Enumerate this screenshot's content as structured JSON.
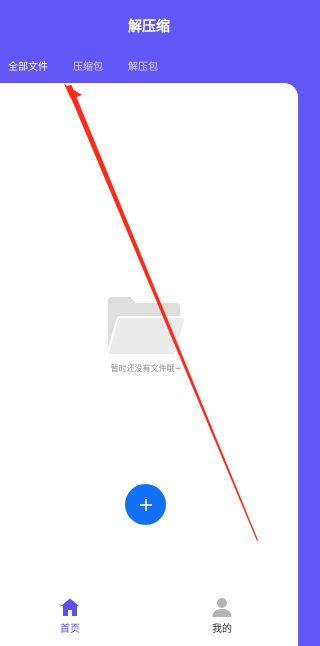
{
  "header": {
    "title": "解压缩"
  },
  "tabs": [
    {
      "label": "全部文件",
      "active": true
    },
    {
      "label": "压缩包",
      "active": false
    },
    {
      "label": "解压包",
      "active": false
    }
  ],
  "empty_state": {
    "icon": "empty-folder-icon",
    "message": "暂时还没有文件哦~"
  },
  "fab": {
    "icon": "plus-icon",
    "color": "#1270f5"
  },
  "bottom_nav": [
    {
      "label": "首页",
      "icon": "home-icon",
      "active": true
    },
    {
      "label": "我的",
      "icon": "user-icon",
      "active": false
    }
  ],
  "colors": {
    "brand": "#6356f7",
    "active_nav": "#5b50f0",
    "annotation_arrow": "#ff2a1a"
  }
}
